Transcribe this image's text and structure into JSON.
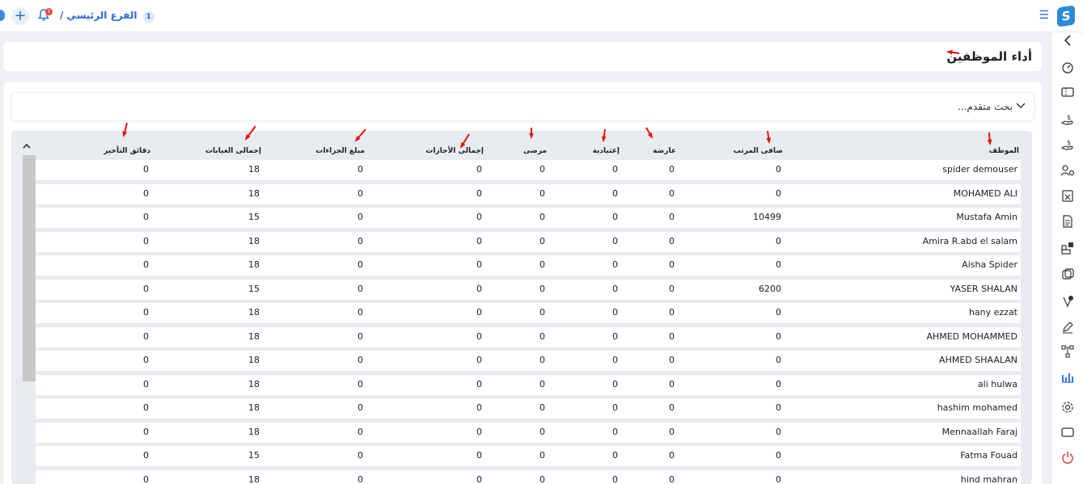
{
  "topbar": {
    "branch_label": "الفرع الرئيسي /",
    "branch_number": "1",
    "notification_count": "0",
    "add_symbol": "+"
  },
  "page": {
    "title": "أداء الموظفين"
  },
  "advanced_search": {
    "label": "بحث متقدم..."
  },
  "table": {
    "columns": [
      "الموظف",
      "صافى المرتب",
      "عارضة",
      "إعتيادية",
      "مرضى",
      "إجمالى الأجازات",
      "مبلغ الجزاءات",
      "إجمالى الغيابات",
      "دقائق التأخير"
    ],
    "rows": [
      [
        "spider demouser",
        "0",
        "0",
        "0",
        "0",
        "0",
        "0",
        "18",
        "0"
      ],
      [
        "MOHAMED ALI",
        "0",
        "0",
        "0",
        "0",
        "0",
        "0",
        "18",
        "0"
      ],
      [
        "Mustafa Amin",
        "10499",
        "0",
        "0",
        "0",
        "0",
        "0",
        "15",
        "0"
      ],
      [
        "Amira R.abd el salam",
        "0",
        "0",
        "0",
        "0",
        "0",
        "0",
        "18",
        "0"
      ],
      [
        "Aisha Spider",
        "0",
        "0",
        "0",
        "0",
        "0",
        "0",
        "18",
        "0"
      ],
      [
        "YASER SHALAN",
        "6200",
        "0",
        "0",
        "0",
        "0",
        "0",
        "15",
        "0"
      ],
      [
        "hany ezzat",
        "0",
        "0",
        "0",
        "0",
        "0",
        "0",
        "18",
        "0"
      ],
      [
        "AHMED MOHAMMED",
        "0",
        "0",
        "0",
        "0",
        "0",
        "0",
        "18",
        "0"
      ],
      [
        "AHMED SHAALAN",
        "0",
        "0",
        "0",
        "0",
        "0",
        "0",
        "18",
        "0"
      ],
      [
        "ali hulwa",
        "0",
        "0",
        "0",
        "0",
        "0",
        "0",
        "18",
        "0"
      ],
      [
        "hashim mohamed",
        "0",
        "0",
        "0",
        "0",
        "0",
        "0",
        "18",
        "0"
      ],
      [
        "Mennaallah Faraj",
        "0",
        "0",
        "0",
        "0",
        "0",
        "0",
        "18",
        "0"
      ],
      [
        "Fatma Fouad",
        "0",
        "0",
        "0",
        "0",
        "0",
        "0",
        "15",
        "0"
      ],
      [
        "hind mahran",
        "0",
        "0",
        "0",
        "0",
        "0",
        "0",
        "18",
        "0"
      ]
    ]
  },
  "colors": {
    "accent": "#2a6ad9",
    "annotation_arrow": "#e8140c",
    "power": "#d9342b"
  },
  "sidebar_icons": [
    "collapse-chevron-icon",
    "dashboard-gauge-icon",
    "ticket-icon",
    "salary-hand-icon",
    "payment-hand-icon",
    "users-settings-icon",
    "calendar-x-icon",
    "document-icon",
    "apps-plus-icon",
    "transfer-icon",
    "approval-icon",
    "edit-pen-icon",
    "hierarchy-icon",
    "reports-chart-icon",
    "settings-gear-icon",
    "screen-icon",
    "power-icon"
  ]
}
